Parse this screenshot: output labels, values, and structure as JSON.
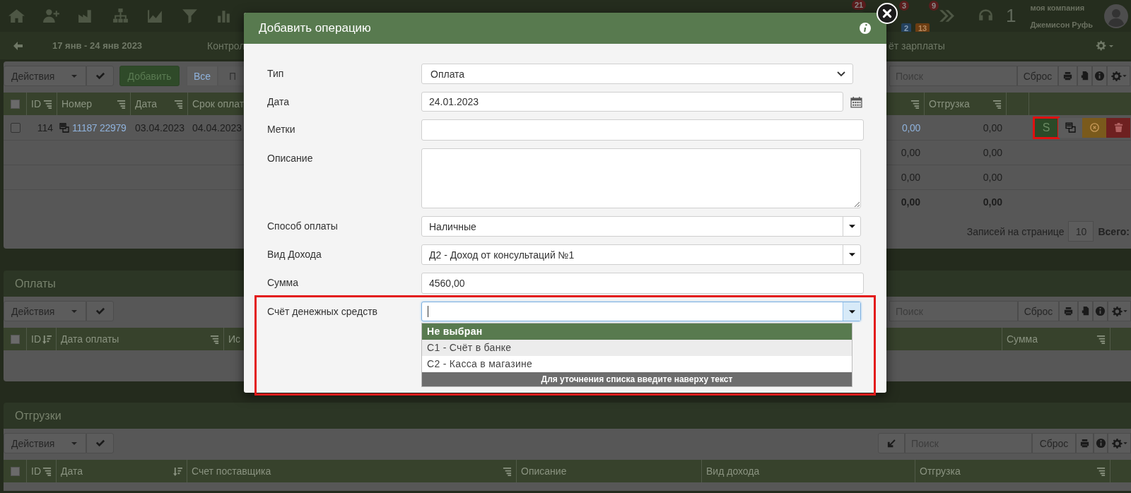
{
  "nav": {
    "mail_count": "21",
    "tasks_count": "3",
    "tasks_sub": [
      "2",
      "13"
    ],
    "chevron_count": "9",
    "counter": "1",
    "company": "моя компания",
    "user": "Джемисон Руфь"
  },
  "subbar": {
    "period": "17 янв - 24 янв 2023",
    "left_link": "Контрол",
    "right_link": "ёт зарплаты"
  },
  "main_panel": {
    "toolbar": {
      "actions": "Действия",
      "add": "Добавить",
      "filters": [
        {
          "label": "Все",
          "selected": true
        },
        {
          "label": "П",
          "selected": false
        }
      ],
      "search_placeholder": "Поиск",
      "reset": "Сброс"
    },
    "select_all_checked": false,
    "left_columns": [
      "ID",
      "Номер",
      "Дата",
      "Срок оплат"
    ],
    "right_column": "Отгрузка",
    "rows": [
      {
        "kind": "item",
        "checked": false,
        "id": "114",
        "number": "11187 22979",
        "date": "03.04.2023",
        "due": "04.04.2023",
        "paid": "0,00",
        "shipped": "0,00",
        "pay_label": "S",
        "pay_highlighted": true
      },
      {
        "kind": "plain",
        "paid": "0,00",
        "shipped": "0,00"
      },
      {
        "kind": "plain",
        "paid": "0,00",
        "shipped": "0,00"
      },
      {
        "kind": "total",
        "paid": "0,00",
        "shipped": "0,00"
      }
    ],
    "pagination": {
      "label": "Записей на странице",
      "per_page": "10",
      "total_label": "Всего:"
    }
  },
  "payments": {
    "title": "Оплаты",
    "actions": "Действия",
    "search_placeholder": "Поиск",
    "reset": "Сброс",
    "select_all_checked": false,
    "left_columns": [
      "ID",
      "Дата оплаты",
      "Ис"
    ],
    "right_column": "Сумма"
  },
  "shipments": {
    "title": "Отгрузки",
    "actions": "Действия",
    "search_placeholder": "Поиск",
    "reset": "Сброс",
    "select_all_checked": false,
    "columns": [
      "ID",
      "Дата",
      "Счет поставщика",
      "Описание",
      "Вид дохода",
      "Отгрузка"
    ]
  },
  "modal": {
    "title": "Добавить операцию",
    "fields": [
      {
        "kind": "select",
        "label": "Тип",
        "value": "Оплата"
      },
      {
        "kind": "date",
        "label": "Дата",
        "value": "24.01.2023"
      },
      {
        "kind": "text",
        "label": "Метки"
      },
      {
        "kind": "textarea",
        "label": "Описание"
      },
      {
        "kind": "combo",
        "label": "Способ оплаты",
        "value": "Наличные"
      },
      {
        "kind": "combo",
        "label": "Вид Дохода",
        "value": "Д2 - Доход от консультаций №1"
      },
      {
        "kind": "text",
        "label": "Сумма",
        "value": "4560,00"
      },
      {
        "kind": "combo_open",
        "label": "Счёт денежных средств",
        "focused": true,
        "highlighted": true,
        "options": [
          {
            "label": "Не выбран",
            "selected": true,
            "hovered": false
          },
          {
            "label": "С1 - Счёт в банке",
            "selected": false,
            "hovered": true
          },
          {
            "label": "С2 - Касса в магазине",
            "selected": false,
            "hovered": false
          }
        ],
        "hint": "Для уточнения списка введите наверху текст"
      }
    ]
  }
}
